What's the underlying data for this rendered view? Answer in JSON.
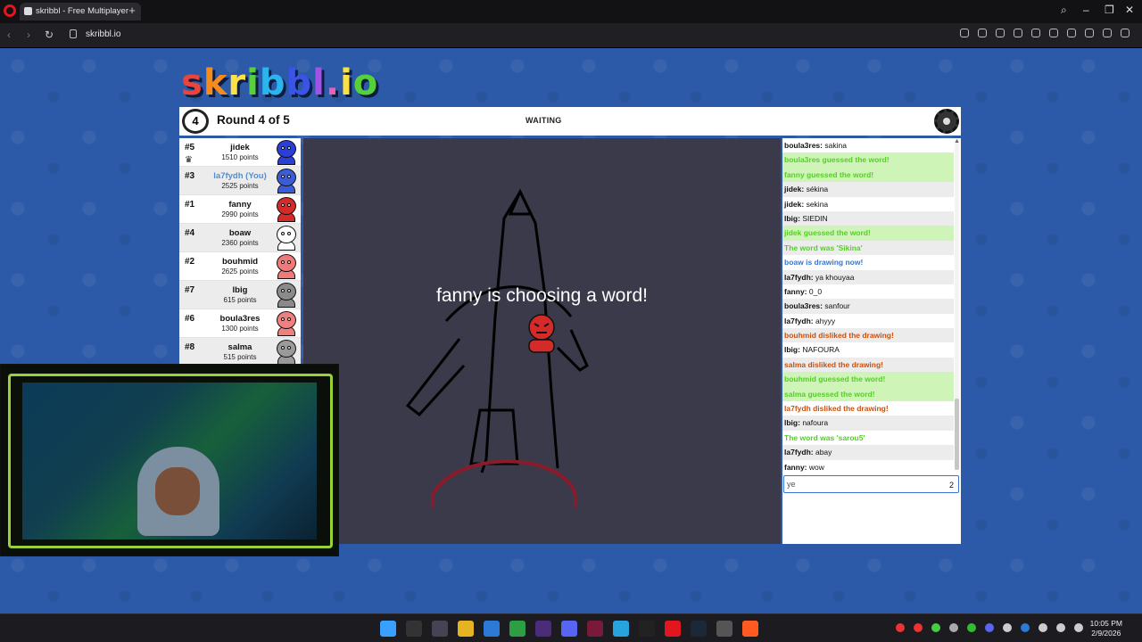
{
  "browser": {
    "tab_title": "skribbl - Free Multiplayer",
    "new_tab": "+",
    "url": "skribbl.io"
  },
  "game": {
    "logo": [
      "s",
      "k",
      "r",
      "i",
      "b",
      "b",
      "l",
      ".",
      "i",
      "o"
    ],
    "round_number": "4",
    "round_label": "Round 4 of 5",
    "status": "WAITING",
    "canvas_message": "fanny is choosing a word!"
  },
  "players": [
    {
      "rank": "#5",
      "name": "jidek",
      "points": "1510 points",
      "color": "#2a3fd8",
      "crown": true
    },
    {
      "rank": "#3",
      "name": "la7fydh (You)",
      "points": "2525 points",
      "color": "#3b5cd6",
      "you": true
    },
    {
      "rank": "#1",
      "name": "fanny",
      "points": "2990 points",
      "color": "#d42a2a"
    },
    {
      "rank": "#4",
      "name": "boaw",
      "points": "2360 points",
      "color": "#ffffff"
    },
    {
      "rank": "#2",
      "name": "bouhmid",
      "points": "2625 points",
      "color": "#f07a7a"
    },
    {
      "rank": "#7",
      "name": "lbig",
      "points": "615 points",
      "color": "#8a8a8a"
    },
    {
      "rank": "#6",
      "name": "boula3res",
      "points": "1300 points",
      "color": "#f08080"
    },
    {
      "rank": "#8",
      "name": "salma",
      "points": "515 points",
      "color": "#9a9a9a"
    }
  ],
  "chat": {
    "messages": [
      {
        "type": "user",
        "user": "boula3res:",
        "text": "sakina"
      },
      {
        "type": "green",
        "text": "boula3res guessed the word!"
      },
      {
        "type": "green",
        "text": "fanny guessed the word!"
      },
      {
        "type": "user",
        "user": "jidek:",
        "text": "sékina"
      },
      {
        "type": "user",
        "user": "jidek:",
        "text": "sekina"
      },
      {
        "type": "user",
        "user": "lbig:",
        "text": "SIEDIN"
      },
      {
        "type": "green",
        "text": "jidek guessed the word!"
      },
      {
        "type": "sys-green",
        "text": "The word was 'Sikina'"
      },
      {
        "type": "blue",
        "text": "boaw is drawing now!"
      },
      {
        "type": "user",
        "user": "la7fydh:",
        "text": "ya khouyaa"
      },
      {
        "type": "user",
        "user": "fanny:",
        "text": "0_0"
      },
      {
        "type": "user",
        "user": "boula3res:",
        "text": "sanfour"
      },
      {
        "type": "user",
        "user": "la7fydh:",
        "text": "ahyyy"
      },
      {
        "type": "red",
        "text": "bouhmid disliked the drawing!"
      },
      {
        "type": "user",
        "user": "lbig:",
        "text": "NAFOURA"
      },
      {
        "type": "red",
        "text": "salma disliked the drawing!"
      },
      {
        "type": "green",
        "text": "bouhmid guessed the word!"
      },
      {
        "type": "green",
        "text": "salma guessed the word!"
      },
      {
        "type": "red",
        "text": "la7fydh disliked the drawing!"
      },
      {
        "type": "user",
        "user": "lbig:",
        "text": "nafoura"
      },
      {
        "type": "sys-green",
        "text": "The word was 'sarou5'"
      },
      {
        "type": "user",
        "user": "la7fydh:",
        "text": "abay"
      },
      {
        "type": "user",
        "user": "fanny:",
        "text": "wow"
      }
    ],
    "input_value": "ye",
    "char_count": "2"
  },
  "taskbar": {
    "time": "10:05 PM",
    "date": "2/9/2026"
  }
}
